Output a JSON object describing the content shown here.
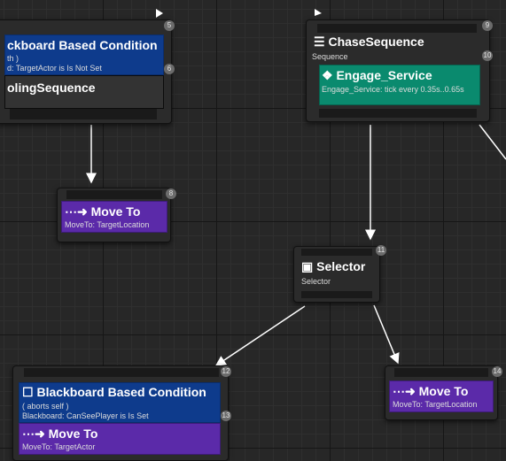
{
  "nodes": {
    "top_left": {
      "decorator_title": "ckboard Based Condition",
      "decorator_sub1": "th )",
      "decorator_sub2": "d: TargetActor is Is Not Set",
      "badge_main": "5",
      "badge_deco": "6",
      "composite_title": "olingSequence"
    },
    "chase": {
      "icon": "sequence-icon",
      "title": "ChaseSequence",
      "subtitle": "Sequence",
      "badge": "9",
      "badge_service": "10",
      "service_title": "Engage_Service",
      "service_sub": "Engage_Service: tick every 0.35s..0.65s"
    },
    "moveto_left": {
      "title": "Move To",
      "subtitle": "MoveTo: TargetLocation",
      "badge": "8"
    },
    "selector": {
      "title": "Selector",
      "subtitle": "Selector",
      "badge": "11"
    },
    "bottom_left": {
      "decorator_title": "Blackboard Based Condition",
      "decorator_sub1": "( aborts self )",
      "decorator_sub2": "Blackboard: CanSeePlayer is Is Set",
      "badge": "12",
      "badge_deco": "13",
      "task_title": "Move To",
      "task_sub": "MoveTo: TargetActor"
    },
    "moveto_right": {
      "title": "Move To",
      "subtitle": "MoveTo: TargetLocation",
      "badge": "14"
    }
  },
  "colors": {
    "decorator": "#0e3b8c",
    "task": "#5b2aa9",
    "service": "#0a8a6e",
    "node_body": "#2b2b2b",
    "wire": "#ffffff"
  }
}
